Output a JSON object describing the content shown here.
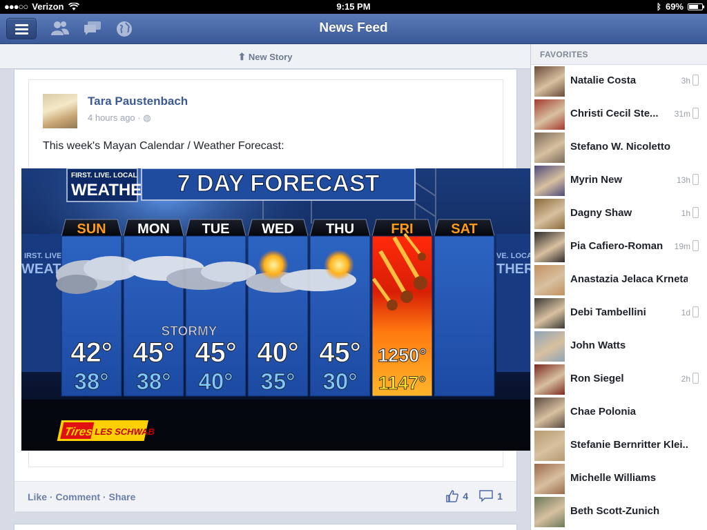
{
  "status_bar": {
    "carrier": "Verizon",
    "time": "9:15 PM",
    "battery": "69%"
  },
  "nav": {
    "title": "News Feed"
  },
  "new_story": {
    "label": "New Story"
  },
  "post": {
    "author": "Tara Paustenbach",
    "time": "4 hours ago",
    "text": "This week's Mayan Calendar / Weather Forecast:",
    "actions": {
      "like": "Like",
      "comment": "Comment",
      "share": "Share"
    },
    "like_count": "4",
    "comment_count": "1"
  },
  "weather_image": {
    "brand_top": "FIRST. LIVE. LOCAL",
    "brand_main": "WEATHER",
    "title": "7 DAY FORECAST",
    "stormy": "STORMY",
    "sponsor_a": "Tires",
    "sponsor_b": "LES SCHWAB",
    "side_left": "IRST. LIVE",
    "side_left2": "WEAT",
    "side_right": "VE. LOCAL",
    "side_right2": "THER",
    "days": [
      {
        "day": "SUN",
        "high": "42°",
        "low": "38°"
      },
      {
        "day": "MON",
        "high": "45°",
        "low": "38°"
      },
      {
        "day": "TUE",
        "high": "45°",
        "low": "40°"
      },
      {
        "day": "WED",
        "high": "40°",
        "low": "35°"
      },
      {
        "day": "THU",
        "high": "45°",
        "low": "30°"
      },
      {
        "day": "FRI",
        "high": "1250°",
        "low": "1147°"
      },
      {
        "day": "SAT",
        "high": "",
        "low": ""
      }
    ]
  },
  "favorites": {
    "header": "FAVORITES",
    "items": [
      {
        "name": "Natalie Costa",
        "ago": "3h",
        "phone": true,
        "color": "#6b4a3a"
      },
      {
        "name": "Christi Cecil Ste...",
        "ago": "31m",
        "phone": true,
        "color": "#a33b2e"
      },
      {
        "name": "Stefano W. Nicoletto",
        "ago": "",
        "phone": false,
        "color": "#7a6a5a"
      },
      {
        "name": "Myrin New",
        "ago": "13h",
        "phone": true,
        "color": "#4d4a7a"
      },
      {
        "name": "Dagny Shaw",
        "ago": "1h",
        "phone": true,
        "color": "#8a6a3a"
      },
      {
        "name": "Pia Cafiero-Roman",
        "ago": "19m",
        "phone": true,
        "color": "#2e2a2a"
      },
      {
        "name": "Anastazia Jelaca Krneta",
        "ago": "",
        "phone": false,
        "color": "#c29060"
      },
      {
        "name": "Debi Tambellini",
        "ago": "1d",
        "phone": true,
        "color": "#3a3a36"
      },
      {
        "name": "John Watts",
        "ago": "",
        "phone": false,
        "color": "#8fa3b5"
      },
      {
        "name": "Ron Siegel",
        "ago": "2h",
        "phone": true,
        "color": "#7a2a22"
      },
      {
        "name": "Chae Polonia",
        "ago": "",
        "phone": false,
        "color": "#5a4a40"
      },
      {
        "name": "Stefanie Bernritter Klei...",
        "ago": "",
        "phone": false,
        "color": "#b59a70"
      },
      {
        "name": "Michelle Williams",
        "ago": "",
        "phone": false,
        "color": "#9a6a4a"
      },
      {
        "name": "Beth Scott-Zunich",
        "ago": "",
        "phone": false,
        "color": "#6a7a5a"
      }
    ]
  }
}
